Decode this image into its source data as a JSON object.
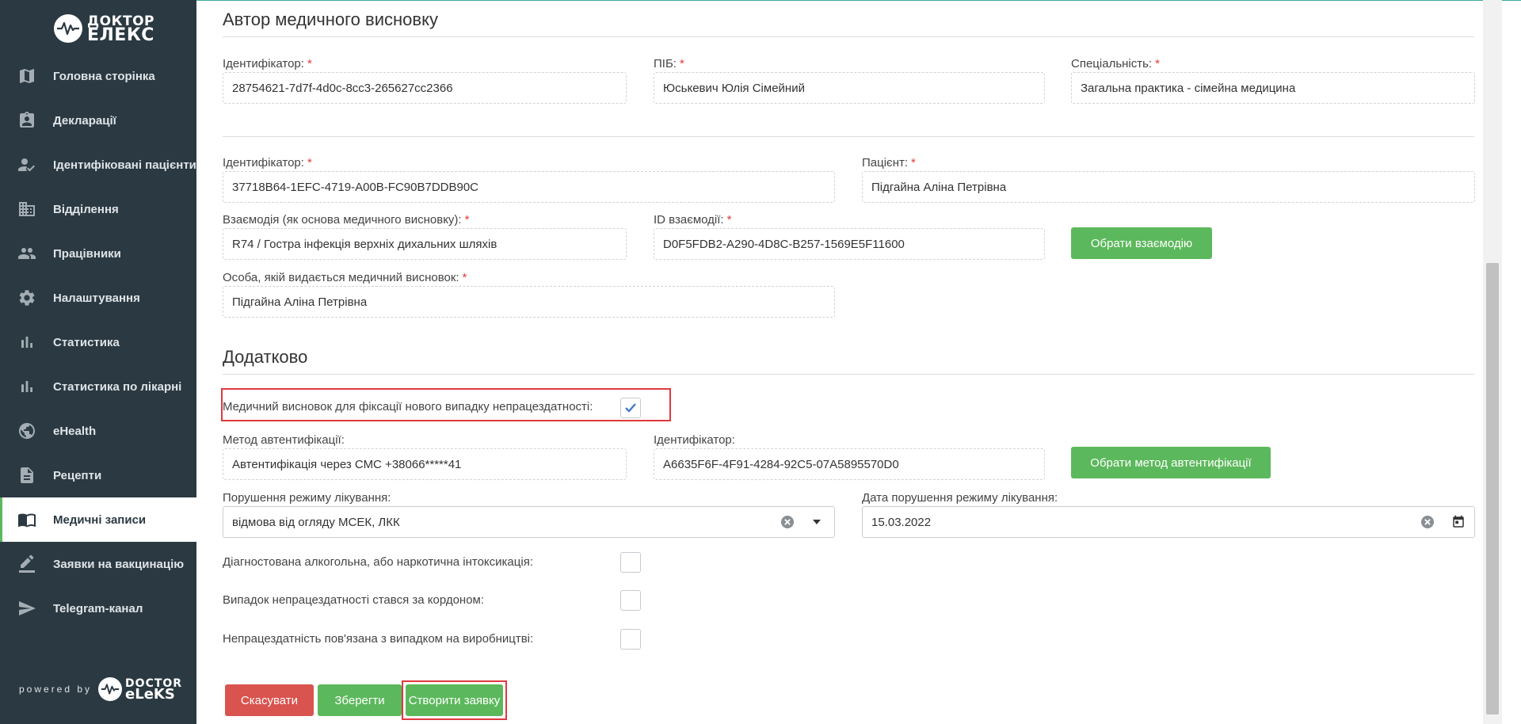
{
  "brand": {
    "logo_line1": "ДОКТОР",
    "logo_line2": "ЕЛЕКС",
    "powered_by": "powered by",
    "powered_line1": "DOCTOR",
    "powered_line2": "eLeKS"
  },
  "sidebar": {
    "items": [
      {
        "label": "Головна сторінка",
        "icon": "map-icon"
      },
      {
        "label": "Декларації",
        "icon": "id-card-icon"
      },
      {
        "label": "Ідентифіковані пацієнти",
        "icon": "user-check-icon"
      },
      {
        "label": "Відділення",
        "icon": "building-icon"
      },
      {
        "label": "Працівники",
        "icon": "people-icon"
      },
      {
        "label": "Налаштування",
        "icon": "gear-icon"
      },
      {
        "label": "Статистика",
        "icon": "bar-chart-icon"
      },
      {
        "label": "Статистика по лікарні",
        "icon": "bar-chart-icon"
      },
      {
        "label": "eHealth",
        "icon": "globe-icon"
      },
      {
        "label": "Рецепти",
        "icon": "document-icon"
      },
      {
        "label": "Медичні записи",
        "icon": "book-icon",
        "active": true
      },
      {
        "label": "Заявки на вакцинацію",
        "icon": "pencil-icon"
      },
      {
        "label": "Telegram-канал",
        "icon": "send-icon"
      }
    ]
  },
  "author_section": {
    "title": "Автор медичного висновку",
    "id_label": "Ідентифікатор:",
    "id_value": "28754621-7d7f-4d0c-8cc3-265627cc2366",
    "name_label": "ПІБ:",
    "name_value": "Юськевич Юлія Сімейний",
    "specialty_label": "Спеціальність:",
    "specialty_value": "Загальна практика - сімейна медицина"
  },
  "patient_section": {
    "id_label": "Ідентифікатор:",
    "id_value": "37718B64-1EFC-4719-A00B-FC90B7DDB90C",
    "patient_label": "Пацієнт:",
    "patient_value": "Підгайна Аліна Петрівна",
    "interaction_label": "Взаємодія (як основа медичного висновку):",
    "interaction_value": "R74 / Гостра інфекція верхніх дихальних шляхів",
    "interaction_id_label": "ID взаємодії:",
    "interaction_id_value": "D0F5FDB2-A290-4D8C-B257-1569E5F11600",
    "choose_interaction_button": "Обрати взаємодію",
    "person_label": "Особа, якій видається медичний висновок:",
    "person_value": "Підгайна Аліна Петрівна"
  },
  "additional_section": {
    "title": "Додатково",
    "new_case_label": "Медичний висновок для фіксації нового випадку непрацездатності:",
    "new_case_checked": true,
    "auth_method_label": "Метод автентифікації:",
    "auth_method_value": "Автентифікація через СМС +38066*****41",
    "auth_id_label": "Ідентифікатор:",
    "auth_id_value": "A6635F6F-4F91-4284-92C5-07A5895570D0",
    "choose_auth_button": "Обрати метод автентифікації",
    "violation_label": "Порушення режиму лікування:",
    "violation_value": "відмова від огляду МСЕК, ЛКК",
    "violation_date_label": "Дата порушення режиму лікування:",
    "violation_date_value": "15.03.2022",
    "alcohol_label": "Діагностована алкогольна, або наркотична інтоксикація:",
    "abroad_label": "Випадок непрацездатності стався за кордоном:",
    "workplace_label": "Непрацездатність пов'язана з випадком на виробництві:"
  },
  "actions": {
    "cancel": "Скасувати",
    "save": "Зберегти",
    "create_request": "Створити заявку"
  },
  "required_mark": "*",
  "colors": {
    "sidebar_bg": "#2b3942",
    "primary_green": "#5cb85c",
    "danger_red": "#d9534f",
    "highlight_red": "#e0393e",
    "required_red": "#e53935"
  }
}
